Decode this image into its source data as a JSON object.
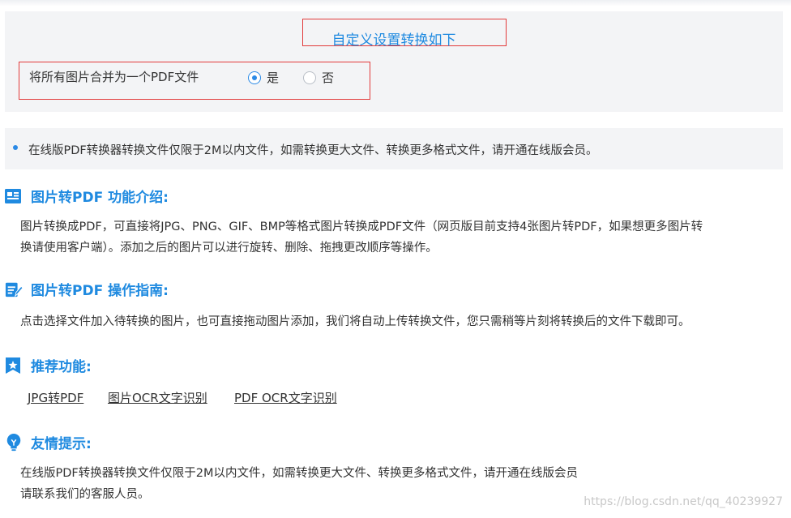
{
  "settings": {
    "custom_title": "自定义设置转换如下",
    "merge_label": "将所有图片合并为一个PDF文件",
    "options": [
      {
        "label": "是",
        "checked": true
      },
      {
        "label": "否",
        "checked": false
      }
    ]
  },
  "notice": {
    "text": "在线版PDF转换器转换文件仅限于2M以内文件，如需转换更大文件、转换更多格式文件，请开通在线版会员。"
  },
  "sections": {
    "intro": {
      "title": "图片转PDF 功能介绍:",
      "line1": "图片转换成PDF，可直接将JPG、PNG、GIF、BMP等格式图片转换成PDF文件（网页版目前支持4张图片转PDF，如果想更多图片转",
      "line2": "换请使用客户端）。添加之后的图片可以进行旋转、删除、拖拽更改顺序等操作。"
    },
    "guide": {
      "title": "图片转PDF 操作指南:",
      "text": "点击选择文件加入待转换的图片，也可直接拖动图片添加，我们将自动上传转换文件，您只需稍等片刻将转换后的文件下载即可。"
    },
    "recommend": {
      "title": "推荐功能:",
      "links": [
        "JPG转PDF",
        "图片OCR文字识别",
        "PDF OCR文字识别"
      ]
    },
    "tips": {
      "title": "友情提示:",
      "line1": "在线版PDF转换器转换文件仅限于2M以内文件，如需转换更大文件、转换更多格式文件，请开通在线版会员",
      "line2": "请联系我们的客服人员。"
    }
  },
  "watermark": "https://blog.csdn.net/qq_40239927",
  "colors": {
    "accent": "#1f8ae0",
    "highlight_border": "#e23b3b",
    "panel_bg": "#f3f4f6",
    "text": "#333333"
  }
}
